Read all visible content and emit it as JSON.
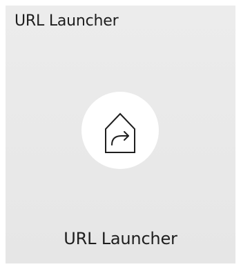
{
  "tile": {
    "title": "URL Launcher",
    "icon": "url-launcher-house-icon",
    "label": "URL Launcher"
  },
  "colors": {
    "tile_background": "#e8e8e8",
    "icon_circle": "#ffffff",
    "text": "#1e1e1e"
  }
}
